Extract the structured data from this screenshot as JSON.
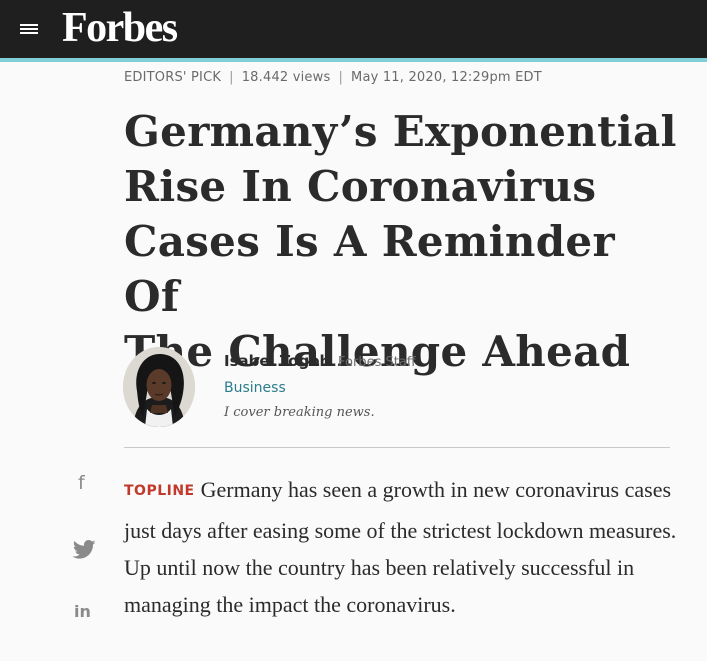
{
  "header": {
    "logo": "Forbes",
    "menu_icon": "hamburger-menu-icon",
    "background_color": "#1f1f1f",
    "accent_color": "#7fd0d9"
  },
  "meta": {
    "label": "EDITORS' PICK",
    "views": "18.442 views",
    "date": "May 11, 2020, 12:29pm EDT"
  },
  "article": {
    "headline_lines": [
      "Germany’s Exponential",
      "Rise In Coronavirus",
      "Cases Is A Reminder Of",
      "The Challenge Ahead"
    ],
    "topline_label": "TOPLINE",
    "topline_color": "#c0392b",
    "lead_text": "Germany has seen a growth in new coronavirus cases just days after easing some of the strictest lockdown measures. Up until now the country has been relatively successful in managing the impact the coronavirus."
  },
  "author": {
    "name": "Isabel Togoh",
    "role": "Forbes Staff",
    "section": "Business",
    "section_color": "#2c7d8c",
    "bio": "I cover breaking news."
  },
  "share": {
    "facebook_glyph": "f",
    "linkedin_glyph": "in",
    "icons": [
      "facebook-icon",
      "twitter-icon",
      "linkedin-icon"
    ]
  }
}
